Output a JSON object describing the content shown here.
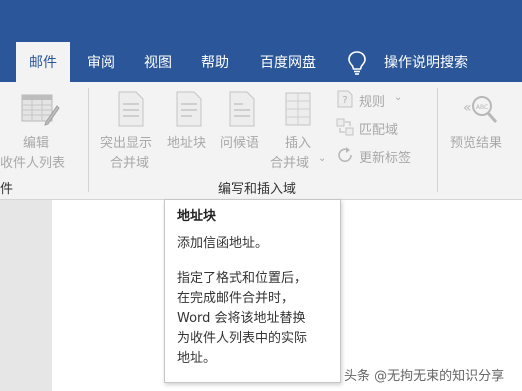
{
  "tabs": [
    {
      "label": "邮件",
      "active": true
    },
    {
      "label": "审阅"
    },
    {
      "label": "视图"
    },
    {
      "label": "帮助"
    },
    {
      "label": "百度网盘"
    }
  ],
  "tell_me": {
    "icon": "lightbulb-icon",
    "label": "操作说明搜索"
  },
  "ribbon": {
    "start_group": {
      "edit_recipients_line1": "编辑",
      "edit_recipients_line2": "收件人列表",
      "label_fragment": "件"
    },
    "write_insert_group": {
      "highlight_fields_line1": "突出显示",
      "highlight_fields_line2": "合并域",
      "address_block": "地址块",
      "greeting_line": "问候语",
      "insert_field_line1": "插入",
      "insert_field_line2": "合并域",
      "rules": "规则",
      "match_fields": "匹配域",
      "update_labels": "更新标签",
      "label": "编写和插入域"
    },
    "preview_group": {
      "preview_results": "预览结果"
    }
  },
  "tooltip": {
    "title": "地址块",
    "subtitle": "添加信函地址。",
    "body_lines": [
      "指定了格式和位置后，",
      "在完成邮件合并时，",
      "Word 会将该地址替换",
      "为收件人列表中的实际",
      "地址。"
    ]
  },
  "watermark": "头条 @无拘无束的知识分享",
  "colors": {
    "accent": "#2b579a",
    "ribbon_bg": "#f3f3f3",
    "disabled_text": "#a8a8a8"
  }
}
